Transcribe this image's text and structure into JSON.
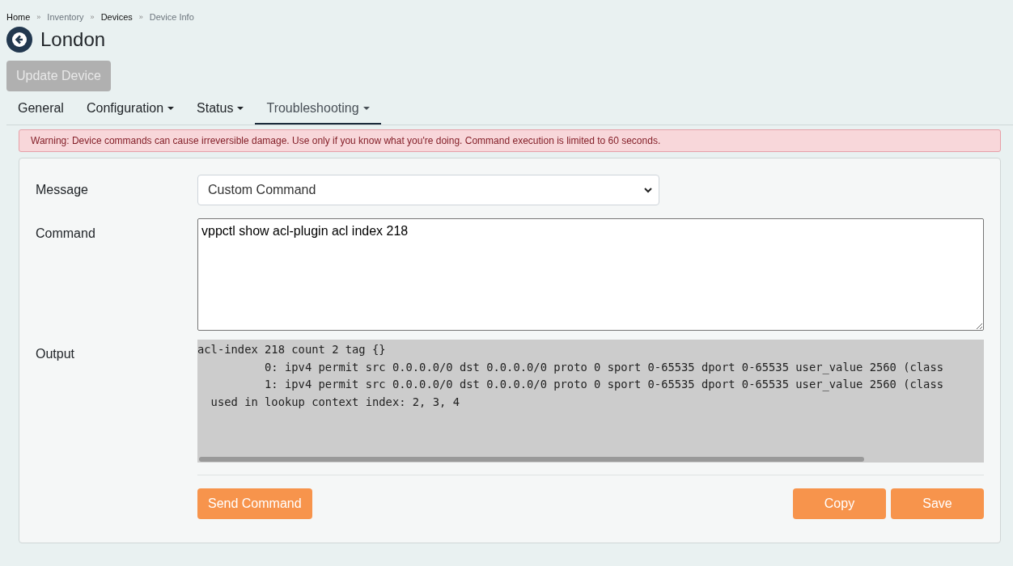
{
  "breadcrumb": {
    "separator": "»",
    "items": [
      {
        "label": "Home",
        "link": true
      },
      {
        "label": "Inventory",
        "link": false
      },
      {
        "label": "Devices",
        "link": true
      },
      {
        "label": "Device Info",
        "link": false
      }
    ]
  },
  "title": "London",
  "update_button": {
    "label": "Update Device",
    "disabled": true
  },
  "tabs": [
    {
      "label": "General",
      "dropdown": false,
      "selected": false
    },
    {
      "label": "Configuration",
      "dropdown": true,
      "selected": false
    },
    {
      "label": "Status",
      "dropdown": true,
      "selected": false
    },
    {
      "label": "Troubleshooting",
      "dropdown": true,
      "selected": true
    }
  ],
  "warning": "Warning: Device commands can cause irreversible damage. Use only if you know what you're doing. Command execution is limited to 60 seconds.",
  "form": {
    "message_label": "Message",
    "message_value": "Custom Command",
    "command_label": "Command",
    "command_value": "vppctl show acl-plugin acl index 218",
    "output_label": "Output",
    "output_lines": [
      "acl-index 218 count 2 tag {}",
      "          0: ipv4 permit src 0.0.0.0/0 dst 0.0.0.0/0 proto 0 sport 0-65535 dport 0-65535 user_value 2560 (class",
      "          1: ipv4 permit src 0.0.0.0/0 dst 0.0.0.0/0 proto 0 sport 0-65535 dport 0-65535 user_value 2560 (class",
      "  used in lookup context index: 2, 3, 4"
    ]
  },
  "buttons": {
    "send": "Send Command",
    "copy": "Copy",
    "save": "Save"
  }
}
